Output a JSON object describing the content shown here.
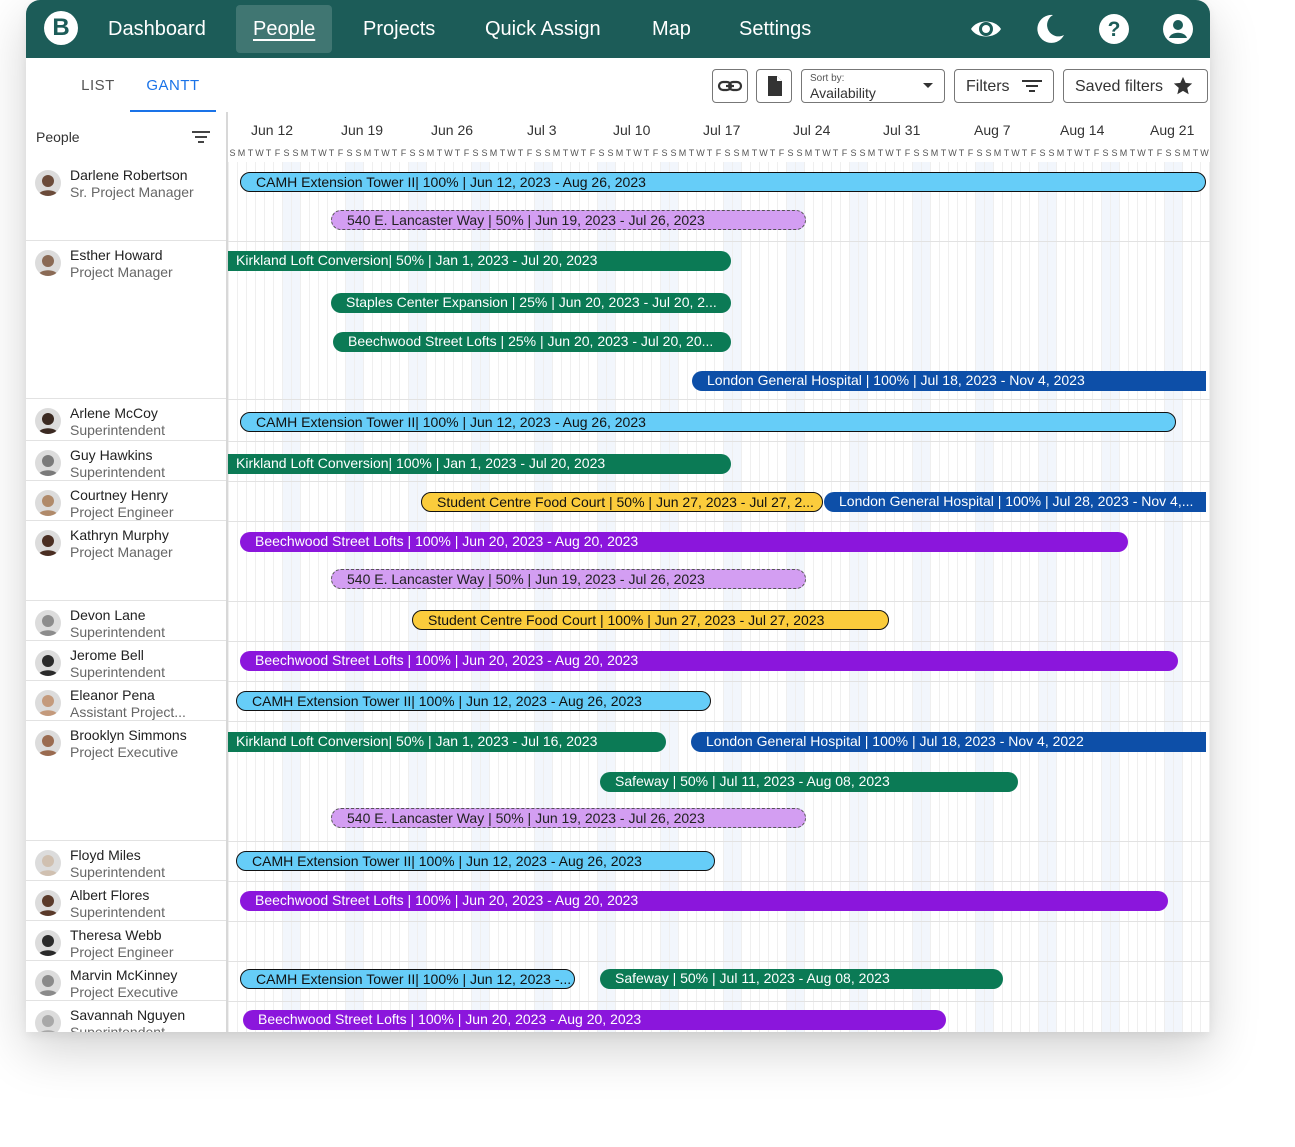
{
  "nav": {
    "logo_letter": "B",
    "items": [
      "Dashboard",
      "People",
      "Projects",
      "Quick Assign",
      "Map",
      "Settings"
    ],
    "active": "People",
    "icons": [
      "eye-icon",
      "moon-icon",
      "help-icon",
      "account-icon"
    ]
  },
  "toolbar": {
    "tabs": [
      "LIST",
      "GANTT"
    ],
    "active_tab": "GANTT",
    "sort_label": "Sort by:",
    "sort_value": "Availability",
    "filters_label": "Filters",
    "saved_filters_label": "Saved filters"
  },
  "people_header": "People",
  "weeks": [
    "Jun 12",
    "Jun 19",
    "Jun 26",
    "Jul 3",
    "Jul 10",
    "Jul 17",
    "Jul 24",
    "Jul 31",
    "Aug 7",
    "Aug 14",
    "Aug 21"
  ],
  "day_letters": [
    "S",
    "M",
    "T",
    "W",
    "T",
    "F",
    "S"
  ],
  "colors": {
    "nav_bg": "#1c5c58",
    "accent": "#1a73e8",
    "cyan": "#66cdf8",
    "lavender": "#d39ef2",
    "green": "#0b7a55",
    "navy": "#0d4fa8",
    "yellow": "#fbcc3c",
    "purple": "#8b16dc"
  },
  "people": [
    {
      "name": "Darlene Robertson",
      "role": "Sr. Project Manager"
    },
    {
      "name": "Esther Howard",
      "role": "Project Manager"
    },
    {
      "name": "Arlene McCoy",
      "role": "Superintendent"
    },
    {
      "name": "Guy Hawkins",
      "role": "Superintendent"
    },
    {
      "name": "Courtney Henry",
      "role": "Project Engineer"
    },
    {
      "name": "Kathryn Murphy",
      "role": "Project Manager"
    },
    {
      "name": "Devon Lane",
      "role": "Superintendent"
    },
    {
      "name": "Jerome Bell",
      "role": "Superintendent"
    },
    {
      "name": "Eleanor Pena",
      "role": "Assistant Project..."
    },
    {
      "name": "Brooklyn Simmons",
      "role": "Project Executive"
    },
    {
      "name": "Floyd Miles",
      "role": "Superintendent"
    },
    {
      "name": "Albert Flores",
      "role": "Superintendent"
    },
    {
      "name": "Theresa Webb",
      "role": "Project Engineer"
    },
    {
      "name": "Marvin McKinney",
      "role": "Project Executive"
    },
    {
      "name": "Savannah Nguyen",
      "role": "Superintendent"
    }
  ],
  "bars": [
    {
      "label": "CAMH Extension Tower II| 100% | Jun 12, 2023 - Aug 26, 2023",
      "color": "cyan"
    },
    {
      "label": "540 E. Lancaster Way | 50% | Jun 19, 2023 - Jul 26, 2023",
      "color": "lav"
    },
    {
      "label": "Kirkland Loft Conversion| 50% | Jan 1, 2023 - Jul 20, 2023",
      "color": "green"
    },
    {
      "label": "Staples Center Expansion | 25% | Jun 20, 2023 - Jul 20, 2...",
      "color": "green"
    },
    {
      "label": "Beechwood Street Lofts | 25% | Jun 20, 2023 - Jul 20, 20...",
      "color": "green"
    },
    {
      "label": "London General Hospital | 100% | Jul 18, 2023 - Nov 4, 2023",
      "color": "navy"
    },
    {
      "label": "CAMH Extension Tower II| 100% | Jun 12, 2023 - Aug 26, 2023",
      "color": "cyan"
    },
    {
      "label": "Kirkland Loft Conversion| 100% | Jan 1, 2023 - Jul 20, 2023",
      "color": "green"
    },
    {
      "label": "Student Centre Food Court | 50% | Jun 27, 2023 - Jul 27, 2...",
      "color": "yellow"
    },
    {
      "label": "London General Hospital | 100% | Jul 28, 2023 - Nov 4,...",
      "color": "navy"
    },
    {
      "label": "Beechwood Street Lofts | 100% | Jun 20, 2023 - Aug 20, 2023",
      "color": "purple"
    },
    {
      "label": "540 E. Lancaster Way | 50% | Jun 19, 2023 - Jul 26, 2023",
      "color": "lav"
    },
    {
      "label": "Student Centre Food Court | 100% | Jun 27, 2023 - Jul 27, 2023",
      "color": "yellow"
    },
    {
      "label": "Beechwood Street Lofts | 100% | Jun 20, 2023 - Aug 20, 2023",
      "color": "purple"
    },
    {
      "label": "CAMH Extension Tower II| 100% | Jun 12, 2023 - Aug 26, 2023",
      "color": "cyan"
    },
    {
      "label": "Kirkland Loft Conversion| 50% | Jan 1, 2023 - Jul 16, 2023",
      "color": "green"
    },
    {
      "label": "London General Hospital | 100% | Jul 18, 2023 - Nov 4, 2022",
      "color": "navy"
    },
    {
      "label": "Safeway  | 50% | Jul 11,  2023 - Aug 08, 2023",
      "color": "green"
    },
    {
      "label": "540 E. Lancaster Way | 50% | Jun 19, 2023 - Jul 26, 2023",
      "color": "lav"
    },
    {
      "label": "CAMH Extension Tower II| 100% | Jun 12, 2023 - Aug 26, 2023",
      "color": "cyan"
    },
    {
      "label": "Beechwood Street Lofts | 100% | Jun 20, 2023 - Aug 20, 2023",
      "color": "purple"
    },
    {
      "label": "CAMH Extension Tower II| 100% | Jun 12, 2023 -...",
      "color": "cyan"
    },
    {
      "label": "Safeway  | 50% | Jul 11,  2023 - Aug 08, 2023",
      "color": "green"
    },
    {
      "label": "Beechwood Street Lofts | 100% | Jun 20, 2023 - Aug 20, 2023",
      "color": "purple"
    }
  ]
}
